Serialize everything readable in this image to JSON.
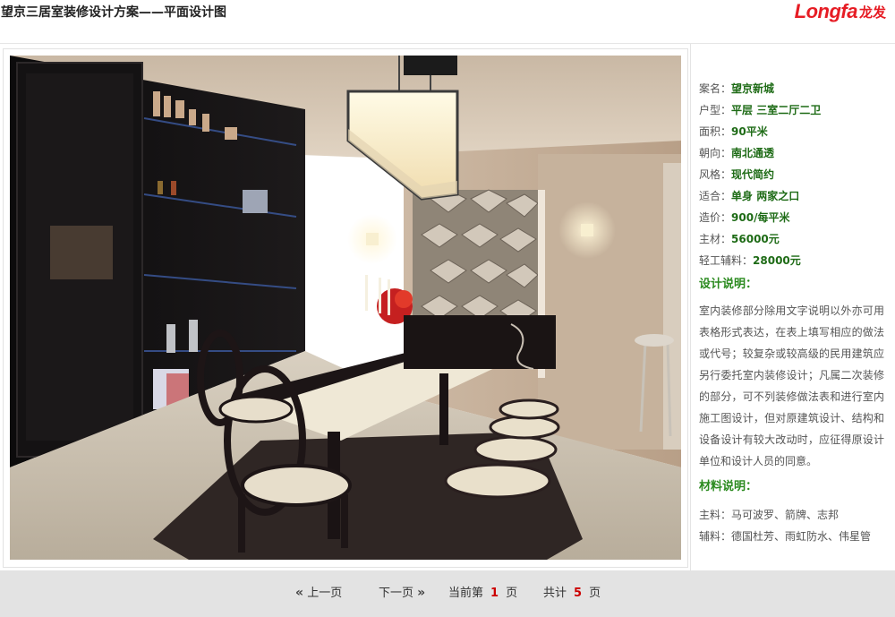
{
  "header": {
    "title": "望京三居室装修设计方案——平面设计图",
    "logo_text": "Longfa",
    "logo_cn": "龙发"
  },
  "specs": [
    {
      "label": "案名：",
      "value": "望京新城"
    },
    {
      "label": "户型：",
      "value": "平层  三室二厅二卫"
    },
    {
      "label": "面积：",
      "value": "90平米"
    },
    {
      "label": "朝向：",
      "value": "南北通透"
    },
    {
      "label": "风格：",
      "value": "现代简约"
    },
    {
      "label": "适合：",
      "value": "单身  两家之口"
    },
    {
      "label": "造价：",
      "value": "900/每平米"
    },
    {
      "label": "主材：",
      "value": "56000元"
    },
    {
      "label": "轻工辅料：",
      "value": "28000元"
    }
  ],
  "design": {
    "title": "设计说明：",
    "text": "室内装修部分除用文字说明以外亦可用表格形式表达，在表上填写相应的做法或代号；较复杂或较高级的民用建筑应另行委托室内装修设计；凡属二次装修的部分，可不列装修做法表和进行室内施工图设计，但对原建筑设计、结构和设备设计有较大改动时，应征得原设计单位和设计人员的同意。"
  },
  "materials": {
    "title": "材料说明：",
    "main": "主料：马可波罗、箭牌、志邦",
    "aux": "辅料：德国杜芳、雨虹防水、伟星管"
  },
  "pager": {
    "prev_arrow": "«",
    "prev_label": "上一页",
    "next_label": "下一页",
    "next_arrow": "»",
    "current_prefix": "当前第",
    "current_page": "1",
    "page_suffix": "页",
    "total_prefix": "共计",
    "total_pages": "5",
    "total_suffix": "页"
  },
  "colors": {
    "accent_green": "#2a8a1e",
    "value_green": "#1e6b16",
    "logo_red": "#e61c24",
    "page_red": "#cc0000"
  }
}
